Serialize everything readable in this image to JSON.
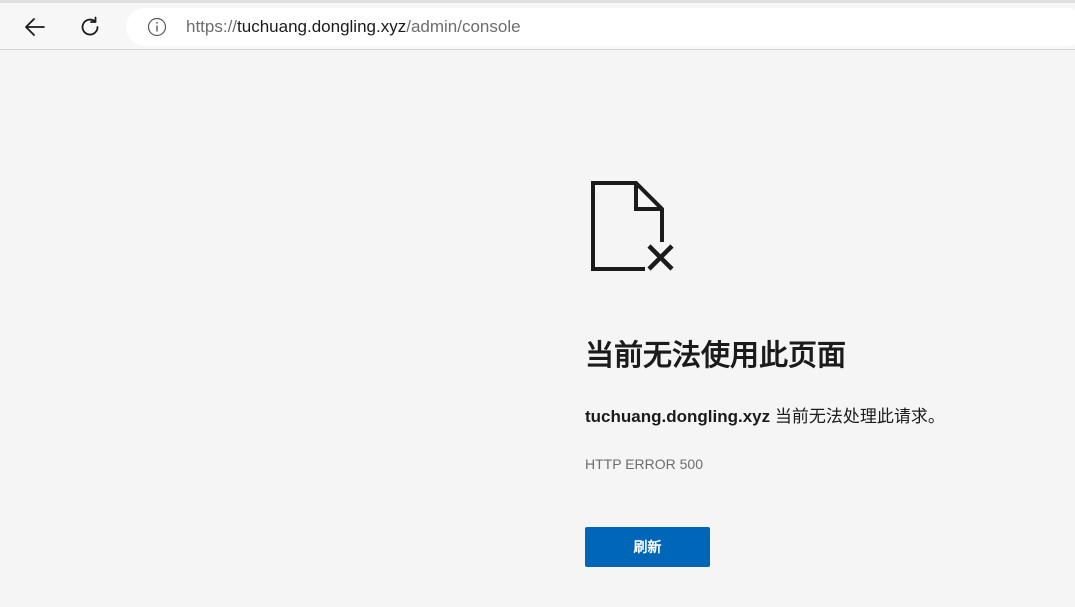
{
  "browser": {
    "back_icon": "arrow-left-icon",
    "reload_icon": "reload-icon",
    "info_icon": "info-icon",
    "url_scheme": "https://",
    "url_host": "tuchuang.dongling.xyz",
    "url_path": "/admin/console"
  },
  "error_page": {
    "icon": "document-error-icon",
    "title": "当前无法使用此页面",
    "message_host": "tuchuang.dongling.xyz",
    "message_text": " 当前无法处理此请求。",
    "error_code": "HTTP ERROR 500",
    "refresh_label": "刷新"
  },
  "colors": {
    "button": "#0067b8",
    "background": "#f5f5f5"
  }
}
